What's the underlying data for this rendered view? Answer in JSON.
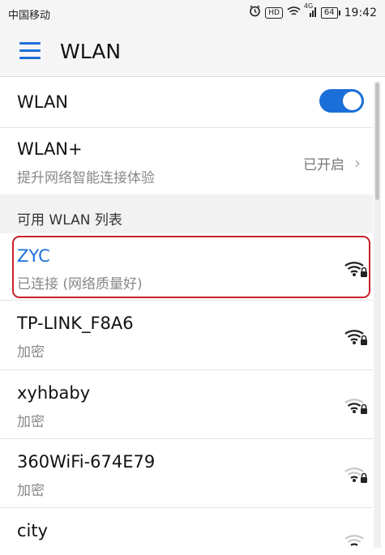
{
  "status_bar": {
    "carrier": "中国移动",
    "hd_badge": "HD",
    "network_type": "4G",
    "battery": "64",
    "time": "19:42",
    "icons": [
      "alarm-icon",
      "hd-icon",
      "wifi-status-icon",
      "signal-icon",
      "battery-icon"
    ]
  },
  "app_bar": {
    "title": "WLAN",
    "menu_icon": "hamburger-menu-icon",
    "accent_color": "#1b6fd8"
  },
  "wlan_toggle": {
    "label": "WLAN",
    "enabled": true
  },
  "wlan_plus": {
    "title": "WLAN+",
    "subtitle": "提升网络智能连接体验",
    "status": "已开启"
  },
  "section": {
    "label": "可用 WLAN 列表"
  },
  "networks": [
    {
      "ssid": "ZYC",
      "status": "已连接 (网络质量好)",
      "secured": true,
      "connected": true,
      "signal": 4,
      "highlight_color": "#c9202a"
    },
    {
      "ssid": "TP-LINK_F8A6",
      "status": "加密",
      "secured": true,
      "connected": false,
      "signal": 4
    },
    {
      "ssid": "xyhbaby",
      "status": "加密",
      "secured": true,
      "connected": false,
      "signal": 3
    },
    {
      "ssid": "360WiFi-674E79",
      "status": "加密",
      "secured": true,
      "connected": false,
      "signal": 2
    },
    {
      "ssid": "city",
      "status": "",
      "secured": true,
      "connected": false,
      "signal": 2
    }
  ]
}
